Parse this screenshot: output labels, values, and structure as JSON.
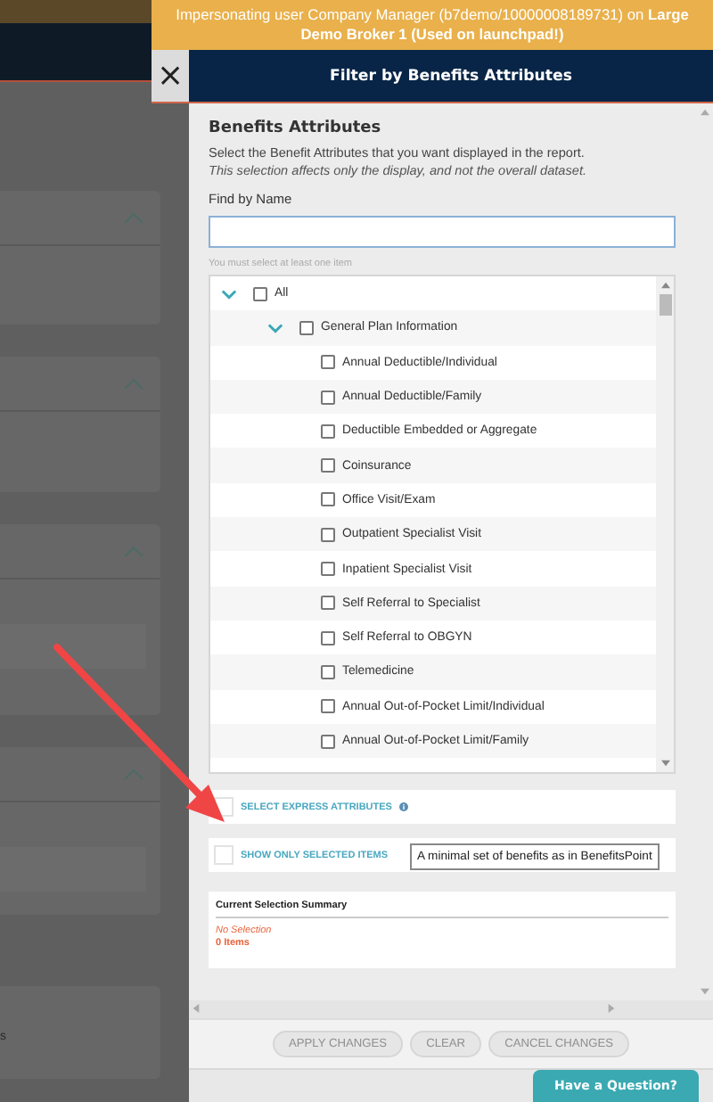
{
  "banner": {
    "text": "Impersonating user Company Manager (b7demo/10000008189731) on **Large Demo Broker 1 (Used on launchpad!)**"
  },
  "close_label": "×",
  "panel": {
    "title": "Filter by Benefits Attributes"
  },
  "section": {
    "heading": "Benefits Attributes",
    "description": "Select the Benefit Attributes that you want displayed in the report.",
    "note": "This selection affects only the display, and not the overall dataset."
  },
  "search": {
    "label": "Find by Name",
    "hint": "You must select at least one item"
  },
  "tree": [
    {
      "label": "All",
      "checked": false,
      "expanded": true,
      "children": [
        {
          "label": "General Plan Information",
          "checked": false,
          "expanded": true,
          "children": [
            {
              "label": "Annual Deductible/Individual",
              "checked": false
            },
            {
              "label": "Annual Deductible/Family",
              "checked": false
            },
            {
              "label": "Deductible Embedded or Aggregate",
              "checked": false
            },
            {
              "label": "Coinsurance",
              "checked": false
            },
            {
              "label": "Office Visit/Exam",
              "checked": false
            },
            {
              "label": "Outpatient Specialist Visit",
              "checked": false
            },
            {
              "label": "Inpatient Specialist Visit",
              "checked": false
            },
            {
              "label": "Self Referral to Specialist",
              "checked": false
            },
            {
              "label": "Self Referral to OBGYN",
              "checked": false
            },
            {
              "label": "Telemedicine",
              "checked": false
            },
            {
              "label": "Annual Out-of-Pocket Limit/Individual",
              "checked": false
            },
            {
              "label": "Annual Out-of-Pocket Limit/Family",
              "checked": false
            }
          ]
        }
      ]
    }
  ],
  "options": [
    {
      "label": "SELECT EXPRESS ATTRIBUTES",
      "checked": false,
      "info": true
    },
    {
      "label": "SHOW ONLY SELECTED ITEMS",
      "checked": false,
      "info": false
    }
  ],
  "tooltip": "A minimal set of benefits as in BenefitsPoint",
  "summary": {
    "title": "Current Selection Summary",
    "selection": "No Selection",
    "count": "0 Items"
  },
  "buttons": [
    {
      "label": "APPLY CHANGES",
      "disabled": true
    },
    {
      "label": "CLEAR",
      "disabled": true
    },
    {
      "label": "CANCEL CHANGES",
      "disabled": true
    }
  ],
  "help_button": "Have a Question?",
  "background_text": "s"
}
